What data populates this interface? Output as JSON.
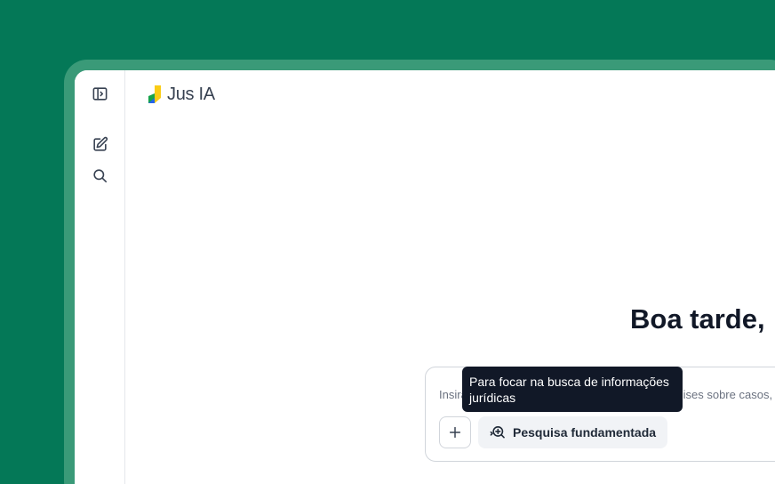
{
  "logo": {
    "text": "Jus IA"
  },
  "sidebar": {
    "items": [
      {
        "icon": "sidebar-toggle-icon"
      },
      {
        "icon": "new-chat-icon"
      },
      {
        "icon": "search-icon"
      }
    ]
  },
  "greeting": "Boa tarde,",
  "composer": {
    "placeholder": "Insira aqui sua pergunta, peça resumos ou análises sobre casos, documentos e temas jurídicos",
    "plus_icon": "plus-icon",
    "research_button": {
      "label": "Pesquisa fundamentada",
      "icon": "search-sparkle-icon"
    }
  },
  "tooltip": {
    "text": "Para focar na busca de informações jurídicas"
  },
  "colors": {
    "background": "#047857",
    "frame": "#3a9a78",
    "tooltip_bg": "#111827",
    "logo_yellow": "#facc15",
    "logo_green": "#16a34a",
    "logo_blue": "#2563eb"
  }
}
